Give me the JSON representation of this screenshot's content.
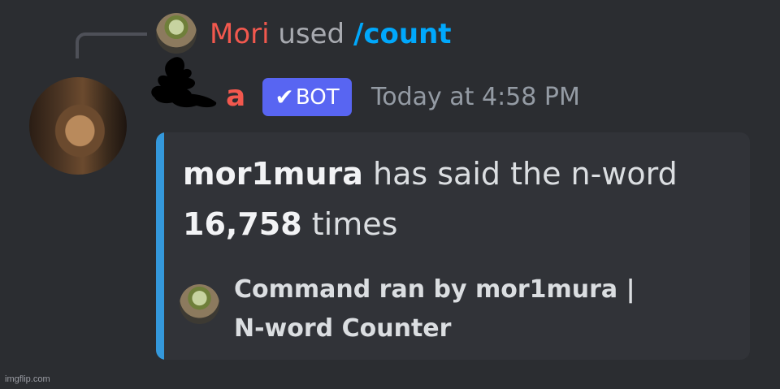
{
  "reply": {
    "username": "Mori",
    "used_text": "used",
    "command": "/count",
    "avatar_icon": "cat-helmet-avatar-icon"
  },
  "message": {
    "bot_name_visible_suffix": "a",
    "bot_badge": "BOT",
    "timestamp": "Today at 4:58 PM",
    "avatar_icon": "anime-character-avatar-icon"
  },
  "embed": {
    "user": "mor1mura",
    "said_text": "has said the n-word",
    "count": "16,758",
    "times_text": "times",
    "footer": "Command ran by mor1mura | N-word Counter",
    "accent_color": "#3498db",
    "footer_avatar_icon": "cat-helmet-avatar-icon"
  },
  "watermark": "imgflip.com"
}
